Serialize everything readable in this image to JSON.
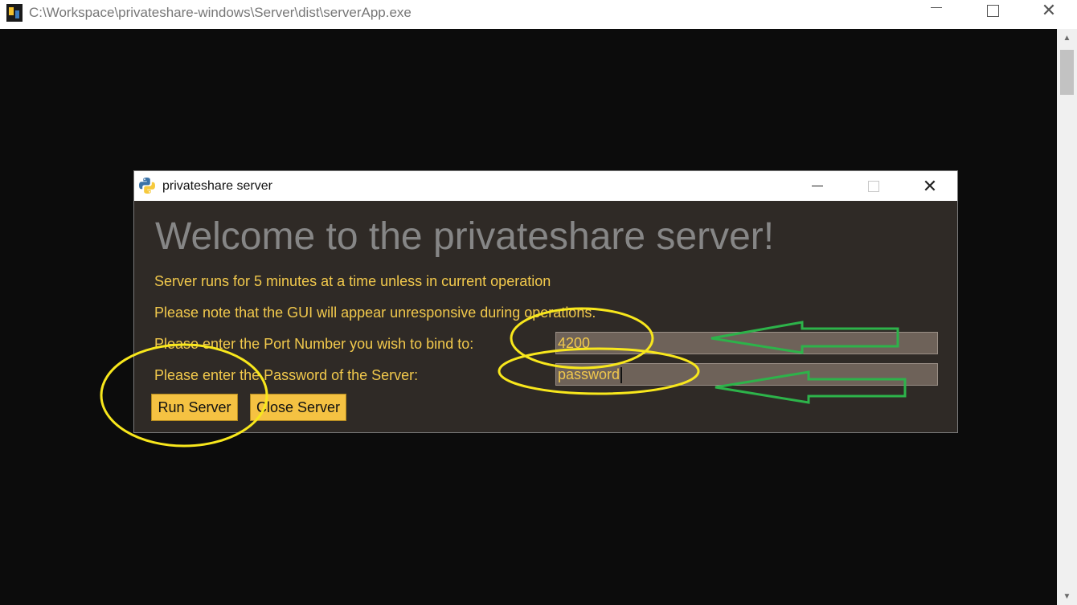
{
  "console": {
    "title": "C:\\Workspace\\privateshare-windows\\Server\\dist\\serverApp.exe",
    "icon": "python-console-icon"
  },
  "dialog": {
    "title": "privateshare server",
    "icon": "python-logo-icon",
    "welcome": "Welcome to the privateshare server!",
    "line1": "Server runs for 5 minutes at a time unless in current operation",
    "line2": "Please note that the GUI will appear unresponsive during operations.",
    "port_label": "Please enter the Port Number you wish to bind to:",
    "password_label": "Please enter the Password of the Server:",
    "port_value": "4200",
    "password_value": "password",
    "run_label": "Run Server",
    "close_label": "Close Server"
  },
  "colors": {
    "background": "#0c0c0c",
    "dialog_bg": "#2f2a26",
    "text_yellow": "#f2c94c",
    "entry_bg": "#6e6259",
    "button_bg": "#f5c242",
    "annotation_ellipse": "#f8e71c",
    "annotation_arrow": "#2db34a"
  }
}
